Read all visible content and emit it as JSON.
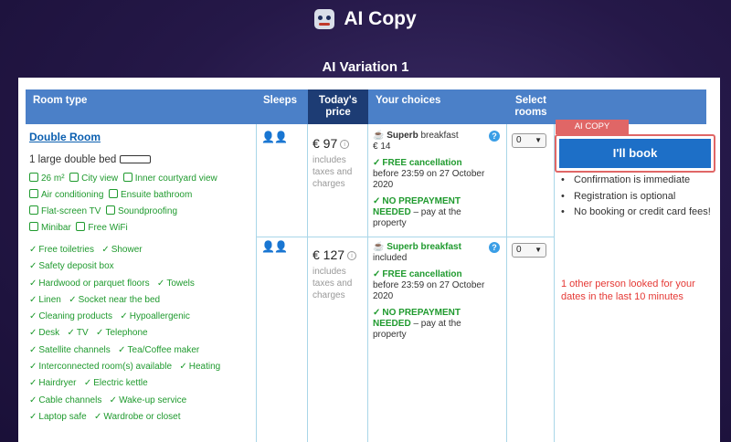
{
  "header": {
    "title": "AI Copy"
  },
  "variation_title": "AI Variation 1",
  "table": {
    "headers": {
      "room_type": "Room type",
      "sleeps": "Sleeps",
      "price": "Today's price",
      "choices": "Your choices",
      "select_rooms": "Select rooms"
    }
  },
  "room": {
    "name": "Double Room",
    "bed": "1 large double bed",
    "amenities": [
      "26 m²",
      "City view",
      "Inner courtyard view",
      "Air conditioning",
      "Ensuite bathroom",
      "Flat-screen TV",
      "Soundproofing",
      "Minibar",
      "Free WiFi"
    ],
    "facilities": [
      [
        "Free toiletries",
        "Shower"
      ],
      [
        "Safety deposit box"
      ],
      [
        "Hardwood or parquet floors",
        "Towels"
      ],
      [
        "Linen",
        "Socket near the bed"
      ],
      [
        "Cleaning products",
        "Hypoallergenic"
      ],
      [
        "Desk",
        "TV",
        "Telephone"
      ],
      [
        "Satellite channels",
        "Tea/Coffee maker"
      ],
      [
        "Interconnected room(s) available",
        "Heating"
      ],
      [
        "Hairdryer",
        "Electric kettle"
      ],
      [
        "Cable channels",
        "Wake-up service"
      ],
      [
        "Laptop safe",
        "Wardrobe or closet"
      ]
    ]
  },
  "offers": [
    {
      "sleeps": "👤👤",
      "price": "€ 97",
      "taxes": "includes taxes and charges",
      "breakfast_title": "Superb",
      "breakfast_rest": "breakfast",
      "breakfast_price": "€ 14",
      "cancel_title": "FREE cancellation",
      "cancel_text": "before 23:59 on 27 October 2020",
      "prepay_title": "NO PREPAYMENT NEEDED",
      "prepay_text": "– pay at the property",
      "rooms_value": "0"
    },
    {
      "sleeps": "👤👤",
      "price": "€ 127",
      "taxes": "includes taxes and charges",
      "breakfast_title": "Superb breakfast",
      "breakfast_rest": "included",
      "cancel_title": "FREE cancellation",
      "cancel_text": "before 23:59 on 27 October 2020",
      "prepay_title": "NO PREPAYMENT NEEDED",
      "prepay_text": "– pay at the property",
      "rooms_value": "0"
    }
  ],
  "booking": {
    "tag": "AI COPY",
    "button": "I'll book",
    "bullets": [
      "Confirmation is immediate",
      "Registration is optional",
      "No booking or credit card fees!"
    ],
    "alert": "1 other person looked for your dates in the last 10 minutes"
  },
  "colors": {
    "header_bar": "#4b80c8",
    "price_header": "#1d3c74",
    "green": "#1f9a2e",
    "book_button": "#1d6fc7",
    "alert": "#e53935",
    "tag": "#e06666"
  }
}
